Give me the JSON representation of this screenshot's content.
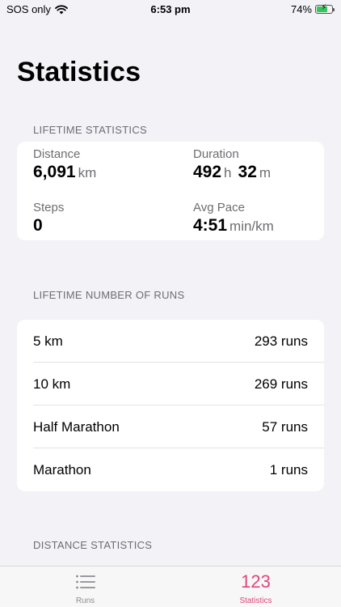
{
  "status_bar": {
    "carrier": "SOS only",
    "time": "6:53 pm",
    "battery": "74%",
    "battery_fraction": 0.74
  },
  "page": {
    "title": "Statistics"
  },
  "lifetime_statistics": {
    "header": "LIFETIME STATISTICS",
    "distance": {
      "label": "Distance",
      "value": "6,091",
      "unit": "km"
    },
    "duration": {
      "label": "Duration",
      "hours": "492",
      "hours_unit": "h",
      "minutes": "32",
      "minutes_unit": "m"
    },
    "steps": {
      "label": "Steps",
      "value": "0"
    },
    "avg_pace": {
      "label": "Avg Pace",
      "value": "4:51",
      "unit": "min/km"
    }
  },
  "lifetime_runs": {
    "header": "LIFETIME NUMBER OF RUNS",
    "rows": [
      {
        "label": "5 km",
        "value": "293 runs"
      },
      {
        "label": "10 km",
        "value": "269 runs"
      },
      {
        "label": "Half Marathon",
        "value": "57 runs"
      },
      {
        "label": "Marathon",
        "value": "1 runs"
      }
    ]
  },
  "distance_statistics": {
    "header": "DISTANCE STATISTICS"
  },
  "tabbar": {
    "runs": {
      "label": "Runs",
      "icon": "list-icon"
    },
    "statistics": {
      "label": "Statistics",
      "icon": "123",
      "active": true
    }
  },
  "colors": {
    "accent": "#e0457b",
    "background": "#f2f2f7",
    "battery": "#34c759"
  }
}
